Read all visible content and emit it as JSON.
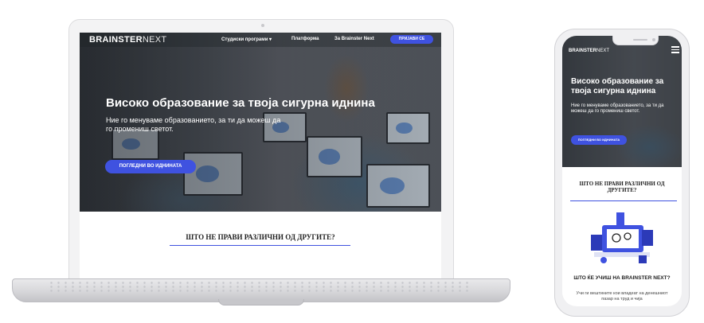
{
  "laptop": {
    "logo_bold": "BRAINSTER",
    "logo_thin": "NEXT",
    "nav": {
      "programs": "Студиски програми ▾",
      "platform": "Платформа",
      "about": "За Brainster Next",
      "cta": "ПРИЈАВИ СЕ"
    },
    "hero": {
      "title": "Високо образование за твоја сигурна иднина",
      "subtitle": "Ние го менуваме образованието, за ти да можеш да го промениш светот.",
      "button": "ПОГЛЕДНИ ВО ИДНИНАТА"
    },
    "section_title": "ШТО НЕ ПРАВИ РАЗЛИЧНИ ОД ДРУГИТЕ?"
  },
  "phone": {
    "logo_bold": "BRAINSTER",
    "logo_thin": "NEXT",
    "hero": {
      "title": "Високо образование за твоја сигурна иднина",
      "subtitle": "Ние го менуваме образованието, за ти да можеш да го промениш светот.",
      "button": "ПОГЛЕДНИ ВО ИДНИНАТА"
    },
    "section_title": "ШТО НЕ ПРАВИ РАЗЛИЧНИ ОД ДРУГИТЕ?",
    "feature_title": "ШТО ЌЕ УЧИШ НА BRAINSTER NEXT?",
    "feature_text": "Учи ги вештините кои владеат на денешниот пазар на труд и чија"
  },
  "colors": {
    "accent": "#3f52e0"
  },
  "icons": [
    "menu-icon",
    "chevron-down-icon"
  ]
}
